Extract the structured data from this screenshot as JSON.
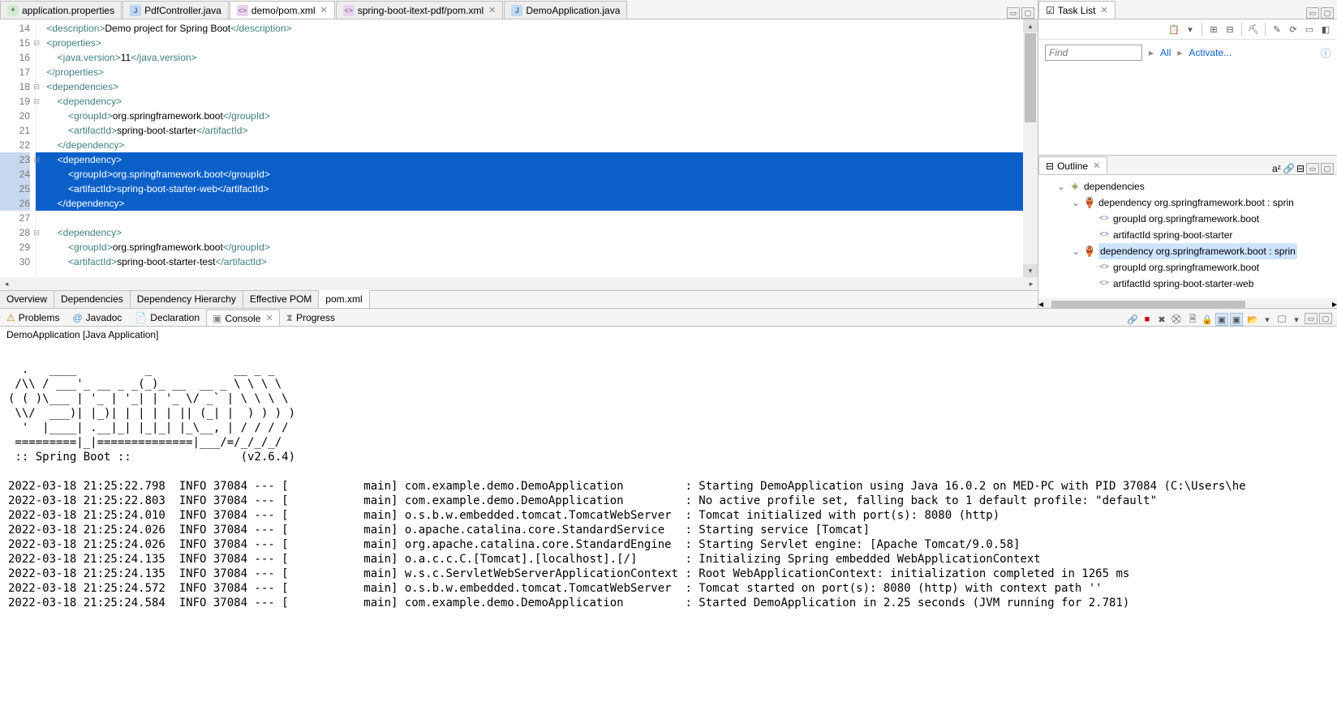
{
  "editor_tabs": [
    {
      "label": "application.properties",
      "icon": "p",
      "active": false,
      "closeable": false
    },
    {
      "label": "PdfController.java",
      "icon": "j",
      "active": false,
      "closeable": false
    },
    {
      "label": "demo/pom.xml",
      "icon": "x",
      "active": true,
      "closeable": true
    },
    {
      "label": "spring-boot-itext-pdf/pom.xml",
      "icon": "x",
      "active": false,
      "closeable": true
    },
    {
      "label": "DemoApplication.java",
      "icon": "j",
      "active": false,
      "closeable": false
    }
  ],
  "lines": [
    {
      "n": 14,
      "html": "    <span class='t-tag'>&lt;description&gt;</span><span class='t-txt'>Demo project for Spring Boot</span><span class='t-tag'>&lt;/description&gt;</span>"
    },
    {
      "n": 15,
      "exp": true,
      "html": "    <span class='t-tag'>&lt;properties&gt;</span>"
    },
    {
      "n": 16,
      "html": "        <span class='t-tag'>&lt;java.version&gt;</span><span class='t-txt'>11</span><span class='t-tag'>&lt;/java.version&gt;</span>"
    },
    {
      "n": 17,
      "html": "    <span class='t-tag'>&lt;/properties&gt;</span>"
    },
    {
      "n": 18,
      "exp": true,
      "html": "    <span class='t-tag'>&lt;dependencies&gt;</span>"
    },
    {
      "n": 19,
      "exp": true,
      "html": "        <span class='t-tag'>&lt;dependency&gt;</span>"
    },
    {
      "n": 20,
      "html": "            <span class='t-tag'>&lt;groupId&gt;</span><span class='t-txt'>org.springframework.boot</span><span class='t-tag'>&lt;/groupId&gt;</span>"
    },
    {
      "n": 21,
      "html": "            <span class='t-tag'>&lt;artifactId&gt;</span><span class='t-txt'>spring-boot-starter</span><span class='t-tag'>&lt;/artifactId&gt;</span>"
    },
    {
      "n": 22,
      "html": "        <span class='t-tag'>&lt;/dependency&gt;</span>"
    },
    {
      "n": 23,
      "sel": true,
      "exp": true,
      "html": "        <span class='t-tag'>&lt;dependency&gt;</span>"
    },
    {
      "n": 24,
      "sel": true,
      "html": "            <span class='t-tag'>&lt;groupId&gt;</span><span class='t-txt'>org.springframework.boot</span><span class='t-tag'>&lt;/groupId&gt;</span>"
    },
    {
      "n": 25,
      "sel": true,
      "html": "            <span class='t-tag'>&lt;artifactId&gt;</span><span class='t-txt'>spring-boot-starter-web</span><span class='t-tag'>&lt;/artifactId&gt;</span>"
    },
    {
      "n": 26,
      "sel": true,
      "html": "        <span class='t-tag'>&lt;/dependency&gt;</span>"
    },
    {
      "n": 27,
      "html": ""
    },
    {
      "n": 28,
      "exp": true,
      "html": "        <span class='t-tag'>&lt;dependency&gt;</span>"
    },
    {
      "n": 29,
      "html": "            <span class='t-tag'>&lt;groupId&gt;</span><span class='t-txt'>org.springframework.boot</span><span class='t-tag'>&lt;/groupId&gt;</span>"
    },
    {
      "n": 30,
      "html": "            <span class='t-tag'>&lt;artifactId&gt;</span><span class='t-txt'>spring-boot-starter-test</span><span class='t-tag'>&lt;/artifactId&gt;</span>"
    }
  ],
  "sub_tabs": [
    "Overview",
    "Dependencies",
    "Dependency Hierarchy",
    "Effective POM",
    "pom.xml"
  ],
  "sub_tab_active": 4,
  "task_list": {
    "title": "Task List",
    "find_placeholder": "Find",
    "all": "All",
    "activate": "Activate..."
  },
  "outline": {
    "title": "Outline",
    "root": "dependencies",
    "deps": [
      {
        "label": "dependency  org.springframework.boot : sprin",
        "sel": false,
        "children": [
          {
            "k": "groupId",
            "v": "org.springframework.boot"
          },
          {
            "k": "artifactId",
            "v": "spring-boot-starter"
          }
        ]
      },
      {
        "label": "dependency  org.springframework.boot : sprin",
        "sel": true,
        "children": [
          {
            "k": "groupId",
            "v": "org.springframework.boot"
          },
          {
            "k": "artifactId",
            "v": "spring-boot-starter-web"
          }
        ]
      }
    ]
  },
  "bottom_tabs": [
    {
      "label": "Problems",
      "icon": "⚠"
    },
    {
      "label": "Javadoc",
      "icon": "@"
    },
    {
      "label": "Declaration",
      "icon": "📄"
    },
    {
      "label": "Console",
      "icon": "▣",
      "active": true,
      "closeable": true
    },
    {
      "label": "Progress",
      "icon": "⧗"
    }
  ],
  "console_title": "DemoApplication [Java Application]",
  "banner": "  .   ____          _            __ _ _\n /\\\\ / ___'_ __ _ _(_)_ __  __ _ \\ \\ \\ \\\n( ( )\\___ | '_ | '_| | '_ \\/ _` | \\ \\ \\ \\\n \\\\/  ___)| |_)| | | | | || (_| |  ) ) ) )\n  '  |____| .__|_| |_|_| |_\\__, | / / / /\n =========|_|==============|___/=/_/_/_/\n :: Spring Boot ::                (v2.6.4)",
  "logs": [
    "2022-03-18 21:25:22.798  INFO 37084 --- [           main] com.example.demo.DemoApplication         : Starting DemoApplication using Java 16.0.2 on MED-PC with PID 37084 (C:\\Users\\he",
    "2022-03-18 21:25:22.803  INFO 37084 --- [           main] com.example.demo.DemoApplication         : No active profile set, falling back to 1 default profile: \"default\"",
    "2022-03-18 21:25:24.010  INFO 37084 --- [           main] o.s.b.w.embedded.tomcat.TomcatWebServer  : Tomcat initialized with port(s): 8080 (http)",
    "2022-03-18 21:25:24.026  INFO 37084 --- [           main] o.apache.catalina.core.StandardService   : Starting service [Tomcat]",
    "2022-03-18 21:25:24.026  INFO 37084 --- [           main] org.apache.catalina.core.StandardEngine  : Starting Servlet engine: [Apache Tomcat/9.0.58]",
    "2022-03-18 21:25:24.135  INFO 37084 --- [           main] o.a.c.c.C.[Tomcat].[localhost].[/]       : Initializing Spring embedded WebApplicationContext",
    "2022-03-18 21:25:24.135  INFO 37084 --- [           main] w.s.c.ServletWebServerApplicationContext : Root WebApplicationContext: initialization completed in 1265 ms",
    "2022-03-18 21:25:24.572  INFO 37084 --- [           main] o.s.b.w.embedded.tomcat.TomcatWebServer  : Tomcat started on port(s): 8080 (http) with context path ''",
    "2022-03-18 21:25:24.584  INFO 37084 --- [           main] com.example.demo.DemoApplication         : Started DemoApplication in 2.25 seconds (JVM running for 2.781)"
  ]
}
